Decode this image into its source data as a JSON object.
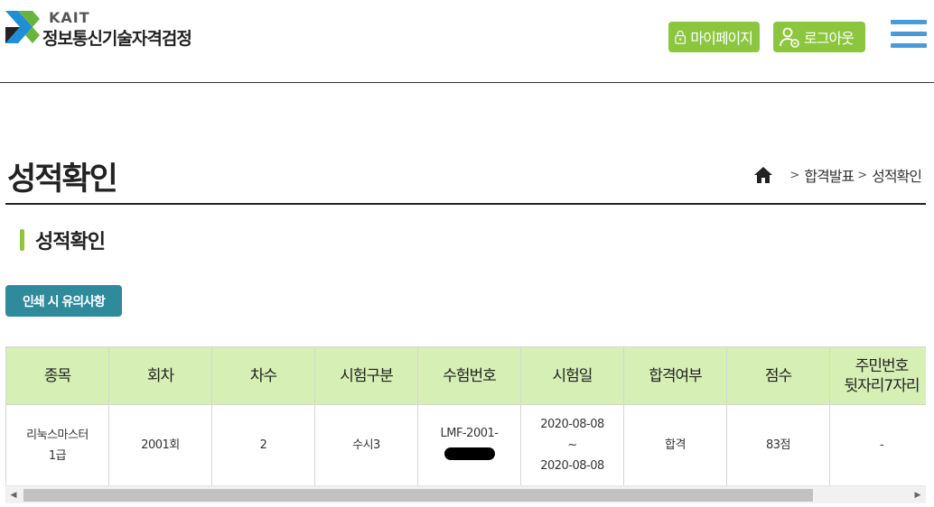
{
  "header": {
    "logo_en": "KAIT",
    "logo_ko": "정보통신기술자격검정",
    "mypage_label": "마이페이지",
    "logout_label": "로그아웃",
    "menu_icon": "hamburger-menu-icon",
    "accent_color": "#8cc63f",
    "menu_color": "#4a9ad8"
  },
  "page": {
    "title": "성적확인",
    "breadcrumb": {
      "home_icon": "home-icon",
      "items": [
        "합격발표",
        "성적확인"
      ]
    },
    "section_title": "성적확인",
    "print_notice_label": "인쇄 시 유의사항",
    "print_button_color": "#2f8a9c"
  },
  "table": {
    "headers": [
      "종목",
      "회차",
      "차수",
      "시험구분",
      "수험번호",
      "시험일",
      "합격여부",
      "점수",
      "주민번호\n뒷자리7자리"
    ],
    "rows": [
      {
        "subject_line1": "리눅스마스터",
        "subject_line2": "1급",
        "round": "2001회",
        "session": "2",
        "exam_type": "수시3",
        "exam_number": "LMF-2001-",
        "exam_date_start": "2020-08-08",
        "exam_date_sep": "~",
        "exam_date_end": "2020-08-08",
        "pass_status": "합격",
        "score": "83점",
        "id_last7": "-"
      }
    ],
    "header_bg": "#d5efb5"
  }
}
